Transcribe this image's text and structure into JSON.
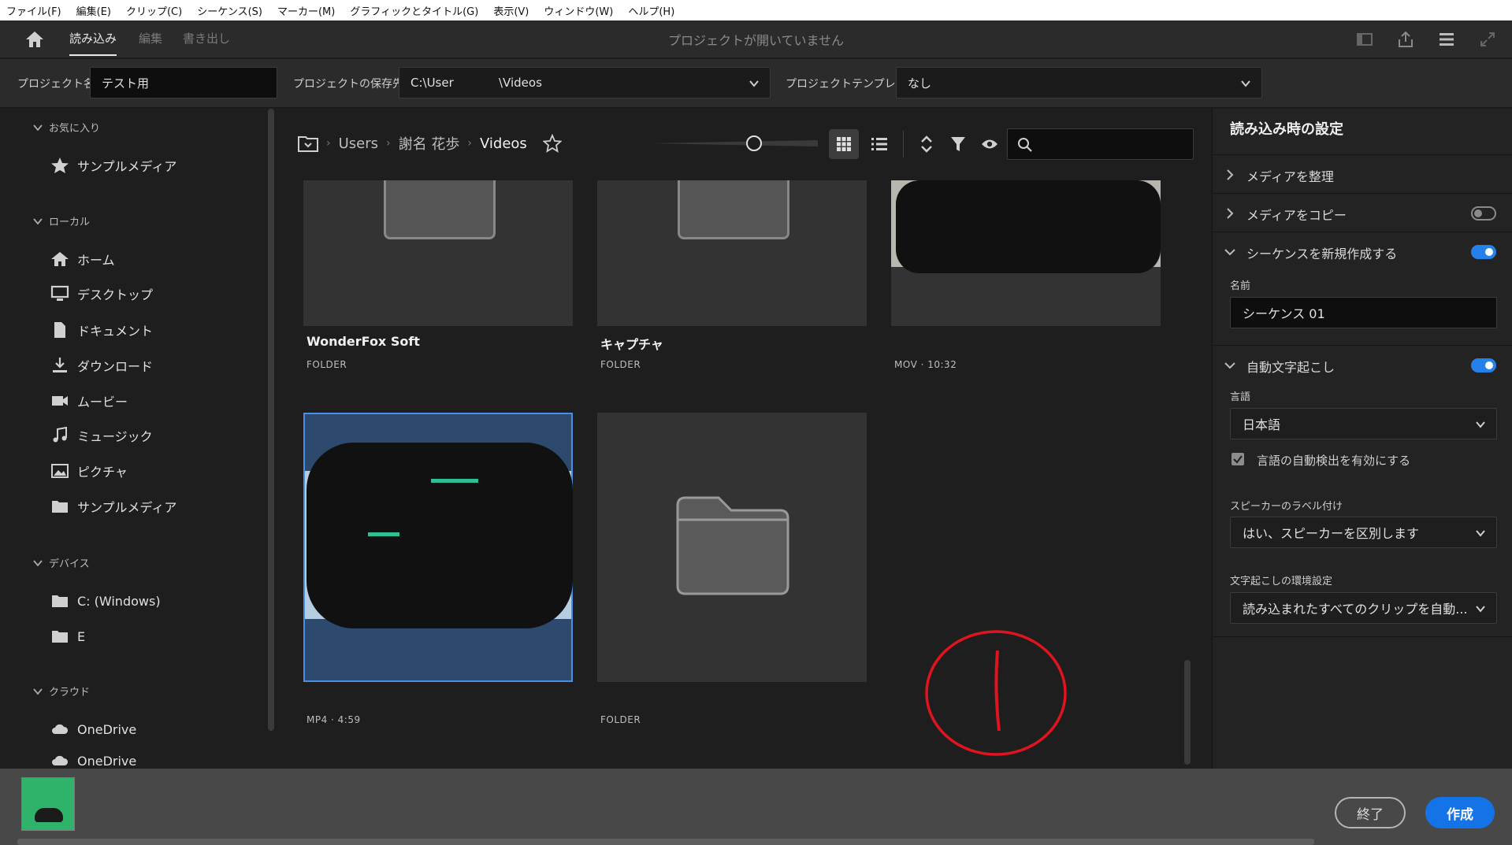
{
  "menu": [
    "ファイル(F)",
    "編集(E)",
    "クリップ(C)",
    "シーケンス(S)",
    "マーカー(M)",
    "グラフィックとタイトル(G)",
    "表示(V)",
    "ウィンドウ(W)",
    "ヘルプ(H)"
  ],
  "nav": {
    "tab_import": "読み込み",
    "tab_edit": "編集",
    "tab_export": "書き出し",
    "status_title": "プロジェクトが開いていません"
  },
  "project": {
    "name_label": "プロジェクト名",
    "name_value": "テスト用",
    "location_label": "プロジェクトの保存先",
    "location_value": "C:\\User            \\Videos",
    "template_label": "プロジェクトテンプレート",
    "template_value": "なし"
  },
  "sidebar": {
    "favorites_heading": "お気に入り",
    "favorites": [
      "サンプルメディア"
    ],
    "local_heading": "ローカル",
    "local": [
      "ホーム",
      "デスクトップ",
      "ドキュメント",
      "ダウンロード",
      "ムービー",
      "ミュージック",
      "ピクチャ",
      "サンプルメディア"
    ],
    "devices_heading": "デバイス",
    "devices": [
      "C: (Windows)",
      "E"
    ],
    "cloud_heading": "クラウド",
    "cloud": [
      "OneDrive",
      "OneDrive"
    ]
  },
  "breadcrumb": {
    "items": [
      "Users",
      "謝名 花歩",
      "Videos"
    ]
  },
  "grid": {
    "cards": [
      {
        "name": "WonderFox Soft",
        "meta": "FOLDER"
      },
      {
        "name": "キャプチャ",
        "meta": "FOLDER"
      },
      {
        "name": "",
        "meta": "MOV · 10:32"
      },
      {
        "name": "",
        "meta": "MP4 · 4:59"
      },
      {
        "name": "",
        "meta": "FOLDER"
      }
    ]
  },
  "settings": {
    "title": "読み込み時の設定",
    "organize_label": "メディアを整理",
    "copy_label": "メディアをコピー",
    "new_sequence_label": "シーケンスを新規作成する",
    "seq_name_label": "名前",
    "seq_name_value": "シーケンス 01",
    "auto_transcribe_label": "自動文字起こし",
    "language_label": "言語",
    "language_value": "日本語",
    "auto_detect_label": "言語の自動検出を有効にする",
    "speaker_label": "スピーカーのラベル付け",
    "speaker_value": "はい、スピーカーを区別します",
    "prefs_label": "文字起こしの環境設定",
    "prefs_value": "読み込まれたすべてのクリップを自動..."
  },
  "footer": {
    "exit_label": "終了",
    "create_label": "作成"
  },
  "colors": {
    "accent": "#1473e6",
    "toggle_on": "#2680eb",
    "selection": "#2d4a6e",
    "annotation": "#e0141e"
  }
}
